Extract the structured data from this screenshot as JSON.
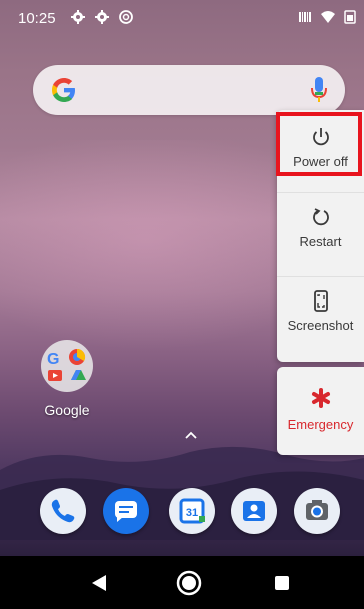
{
  "status_bar": {
    "time": "10:25",
    "left_icons": [
      "settings-icon",
      "settings-icon",
      "sync-icon"
    ],
    "right_icons": [
      "barcode-icon",
      "wifi-icon",
      "battery-icon"
    ]
  },
  "search_bar": {
    "logo": "google-g-logo",
    "voice_icon": "mic-icon"
  },
  "power_menu": {
    "items": [
      {
        "label": "Power off",
        "icon": "power-icon",
        "highlighted": true
      },
      {
        "label": "Restart",
        "icon": "restart-icon"
      },
      {
        "label": "Screenshot",
        "icon": "screenshot-icon"
      }
    ],
    "emergency": {
      "label": "Emergency",
      "icon": "asterisk-icon"
    }
  },
  "home": {
    "folder": {
      "label": "Google"
    }
  },
  "dock": {
    "apps": [
      "phone",
      "messages",
      "calendar",
      "contacts",
      "camera"
    ],
    "calendar_day": "31"
  },
  "nav_bar": {
    "buttons": [
      "back",
      "home",
      "recents"
    ]
  },
  "colors": {
    "highlight": "#e8141e",
    "emergency": "#d8282e",
    "menu_bg": "#f2f2f2"
  }
}
